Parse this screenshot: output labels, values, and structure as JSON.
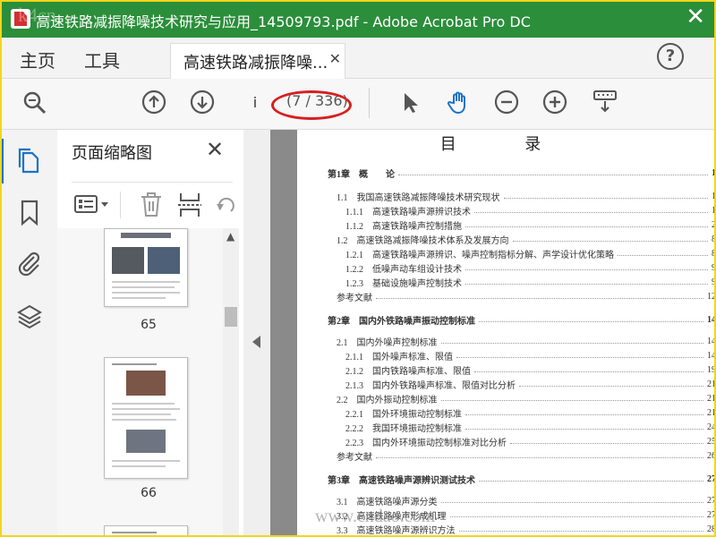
{
  "window": {
    "title": "高速铁路减振降噪技术研究与应用_14509793.pdf - Adobe Acrobat Pro DC",
    "close": "✕",
    "watermark": "k4cn"
  },
  "tabs": {
    "home": "主页",
    "tools": "工具",
    "doc_tab": "高速铁路减振降噪...",
    "doc_tab_close": "✕",
    "help": "?"
  },
  "toolbar": {
    "page_input": "i",
    "page_count": "(7 / 336)"
  },
  "panel": {
    "title": "页面缩略图",
    "close": "✕",
    "thumbnails": [
      {
        "label": "65"
      },
      {
        "label": "66"
      }
    ]
  },
  "toc": {
    "title": "目 录",
    "entries": [
      {
        "text": "第1章　概　　论",
        "page": "1",
        "level": 0
      },
      {
        "text": "1.1　我国高速铁路减振降噪技术研究现状",
        "page": "1",
        "level": 1
      },
      {
        "text": "1.1.1　高速铁路噪声源辨识技术",
        "page": "1",
        "level": 2
      },
      {
        "text": "1.1.2　高速铁路噪声控制措施",
        "page": "2",
        "level": 2
      },
      {
        "text": "1.2　高速铁路减振降噪技术体系及发展方向",
        "page": "8",
        "level": 1
      },
      {
        "text": "1.2.1　高速铁路噪声源辨识、噪声控制指标分解、声学设计优化策略",
        "page": "8",
        "level": 2
      },
      {
        "text": "1.2.2　低噪声动车组设计技术",
        "page": "9",
        "level": 2
      },
      {
        "text": "1.2.3　基础设施噪声控制技术",
        "page": "9",
        "level": 2
      },
      {
        "text": "参考文献",
        "page": "12",
        "level": 1
      },
      {
        "text": "第2章　国内外铁路噪声振动控制标准",
        "page": "14",
        "level": 0
      },
      {
        "text": "2.1　国内外噪声控制标准",
        "page": "14",
        "level": 1
      },
      {
        "text": "2.1.1　国外噪声标准、限值",
        "page": "14",
        "level": 2
      },
      {
        "text": "2.1.2　国内铁路噪声标准、限值",
        "page": "19",
        "level": 2
      },
      {
        "text": "2.1.3　国内外铁路噪声标准、限值对比分析",
        "page": "21",
        "level": 2
      },
      {
        "text": "2.2　国内外振动控制标准",
        "page": "21",
        "level": 1
      },
      {
        "text": "2.2.1　国外环境振动控制标准",
        "page": "21",
        "level": 2
      },
      {
        "text": "2.2.2　我国环境振动控制标准",
        "page": "24",
        "level": 2
      },
      {
        "text": "2.2.3　国内外环境振动控制标准对比分析",
        "page": "25",
        "level": 2
      },
      {
        "text": "参考文献",
        "page": "26",
        "level": 1
      },
      {
        "text": "第3章　高速铁路噪声源辨识测试技术",
        "page": "27",
        "level": 0
      },
      {
        "text": "3.1　高速铁路噪声源分类",
        "page": "27",
        "level": 1
      },
      {
        "text": "3.2　高速铁路噪声形成机理",
        "page": "27",
        "level": 1
      },
      {
        "text": "3.3　高速铁路噪声源辨识方法",
        "page": "28",
        "level": 1
      }
    ]
  },
  "watermark_bottom": "www.cndao.com"
}
